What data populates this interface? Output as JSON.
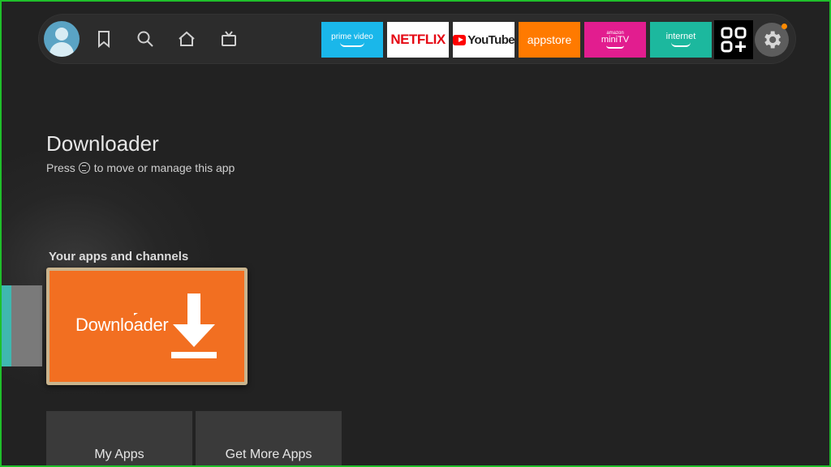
{
  "nav": {
    "icons": [
      "profile-avatar",
      "bookmark-icon",
      "search-icon",
      "home-icon",
      "tv-icon"
    ],
    "apps": [
      {
        "name": "prime video",
        "color": "#1ab7ea"
      },
      {
        "name": "NETFLIX",
        "color": "#e50914"
      },
      {
        "name": "YouTube",
        "color": "#ff0000"
      },
      {
        "name": "appstore",
        "color": "#ff7a00"
      },
      {
        "top": "amazon",
        "name": "miniTV",
        "color": "#e21d8f"
      },
      {
        "name": "internet",
        "color": "#1cb89e"
      }
    ],
    "settings_badge_color": "#ff8a00"
  },
  "focus": {
    "title": "Downloader",
    "hint_before": "Press",
    "hint_after": "to move or manage this app"
  },
  "section_title": "Your apps and channels",
  "featured_app": {
    "label": "Downloader",
    "color": "#f26f21"
  },
  "buttons": {
    "my_apps": "My Apps",
    "get_more_apps": "Get More Apps"
  },
  "frame_color": "#1fbf2a"
}
